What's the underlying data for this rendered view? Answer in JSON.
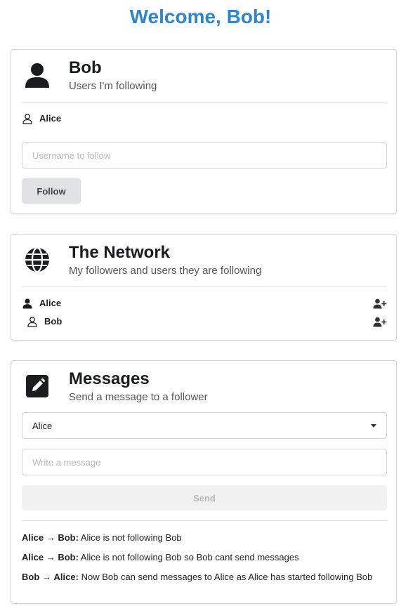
{
  "page": {
    "title": "Welcome, Bob!",
    "accent_color": "#2f85cc"
  },
  "following": {
    "title": "Bob",
    "subtitle": "Users I'm following",
    "icon": "user-icon",
    "users": [
      {
        "name": "Alice",
        "icon": "user-outline-icon"
      }
    ],
    "input_placeholder": "Username to follow",
    "input_value": "",
    "follow_label": "Follow"
  },
  "network": {
    "title": "The Network",
    "subtitle": "My followers and users they are following",
    "icon": "globe-icon",
    "users": [
      {
        "name": "Alice",
        "icon": "user-icon",
        "action_icon": "add-user-icon"
      },
      {
        "name": "Bob",
        "icon": "user-outline-icon",
        "action_icon": "add-user-icon"
      }
    ]
  },
  "messages": {
    "title": "Messages",
    "subtitle": "Send a message to a follower",
    "icon": "edit-icon",
    "recipient_selected": "Alice",
    "message_placeholder": "Write a message",
    "message_value": "",
    "send_label": "Send",
    "log": [
      {
        "from": "Alice",
        "arrow": "→",
        "to": "Bob",
        "text": "Alice is not following Bob"
      },
      {
        "from": "Alice",
        "arrow": "→",
        "to": "Bob",
        "text": "Alice is not following Bob so Bob cant send messages"
      },
      {
        "from": "Bob",
        "arrow": "→",
        "to": "Alice",
        "text": "Now Bob can send messages to Alice as Alice has started following Bob"
      }
    ]
  }
}
